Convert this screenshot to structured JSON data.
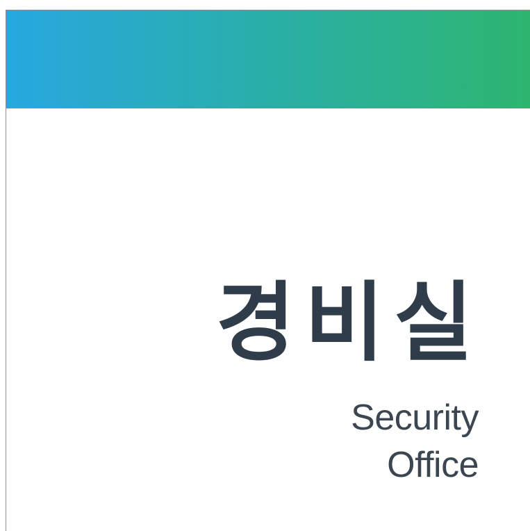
{
  "sign": {
    "title_korean": "경비실",
    "title_english_line1": "Security",
    "title_english_line2": "Office"
  },
  "colors": {
    "band_gradient_start": "#27a8e0",
    "band_gradient_end": "#2db56f",
    "title_text": "#2f3d4a",
    "subtitle_text": "#3b4651",
    "background": "#ffffff"
  }
}
